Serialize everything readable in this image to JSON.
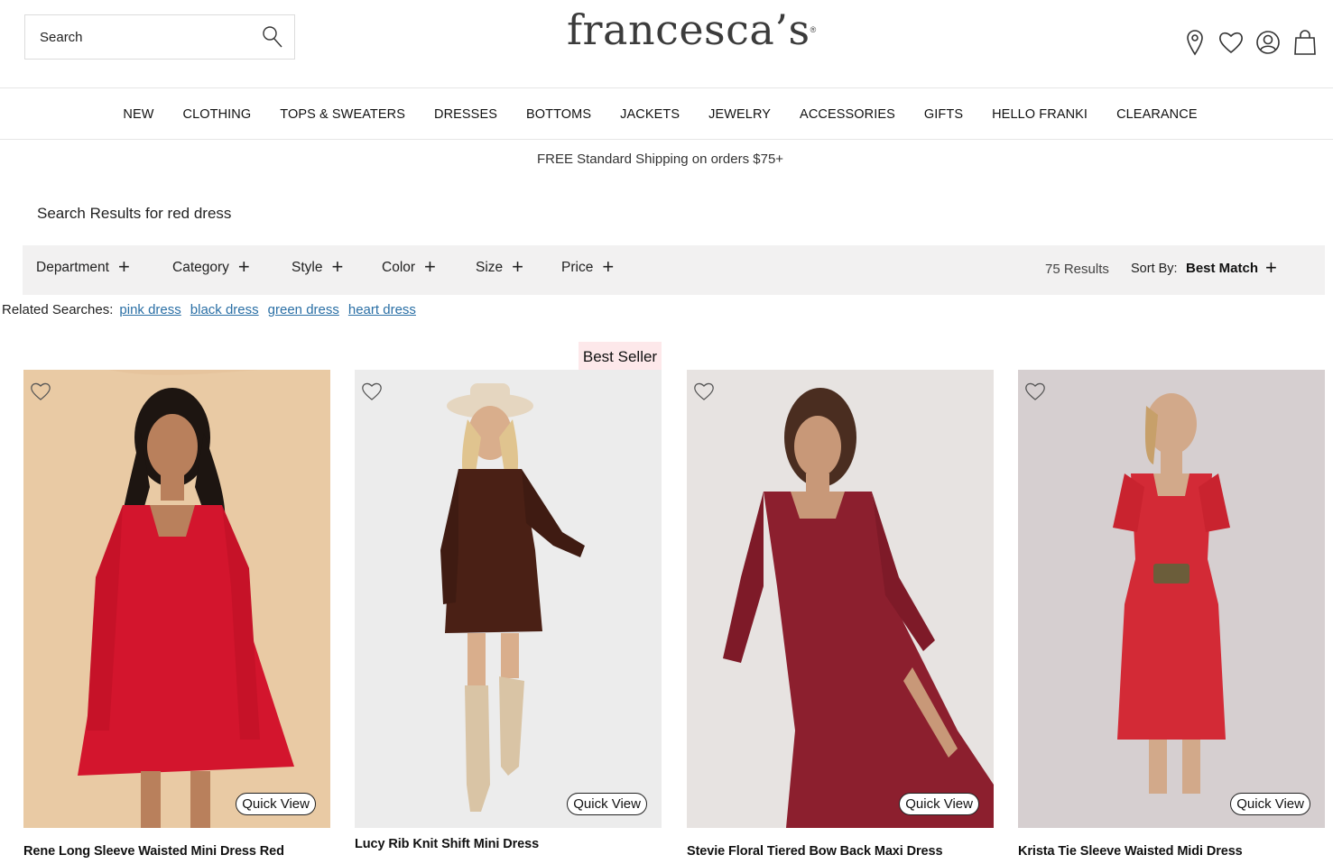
{
  "header": {
    "search_placeholder": "Search",
    "logo_text": "francesca’s",
    "logo_mark": "®"
  },
  "nav": [
    "NEW",
    "CLOTHING",
    "TOPS & SWEATERS",
    "DRESSES",
    "BOTTOMS",
    "JACKETS",
    "JEWELRY",
    "ACCESSORIES",
    "GIFTS",
    "HELLO FRANKI",
    "CLEARANCE"
  ],
  "promo": "FREE Standard Shipping on orders $75+",
  "results_title": "Search Results for red dress",
  "filters": [
    "Department",
    "Category",
    "Style",
    "Color",
    "Size",
    "Price"
  ],
  "results_count": "75 Results",
  "sort": {
    "label": "Sort By:",
    "value": "Best Match"
  },
  "related": {
    "label": "Related Searches:",
    "links": [
      "pink dress",
      "black dress",
      "green dress",
      "heart dress"
    ]
  },
  "badge": "Best Seller",
  "quick_view_label": "Quick View",
  "products": [
    {
      "name": "Rene Long Sleeve Waisted Mini Dress Red",
      "bg": "#e9c9a3",
      "dress": "#d4162e"
    },
    {
      "name": "Lucy Rib Knit Shift Mini Dress",
      "bg": "#ececec",
      "dress": "#4a2015"
    },
    {
      "name": "Stevie Floral Tiered Bow Back Maxi Dress",
      "bg": "#e7e3e1",
      "dress": "#8c1f2e"
    },
    {
      "name": "Krista Tie Sleeve Waisted Midi Dress",
      "bg": "#d6cfd0",
      "dress": "#d32a36"
    }
  ]
}
